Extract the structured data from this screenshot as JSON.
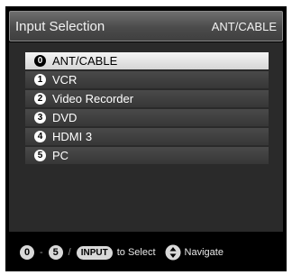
{
  "header": {
    "title": "Input Selection",
    "current_input": "ANT/CABLE"
  },
  "inputs": [
    {
      "number": "0",
      "label": "ANT/CABLE",
      "selected": true
    },
    {
      "number": "1",
      "label": "VCR",
      "selected": false
    },
    {
      "number": "2",
      "label": "Video Recorder",
      "selected": false
    },
    {
      "number": "3",
      "label": "DVD",
      "selected": false
    },
    {
      "number": "4",
      "label": "HDMI 3",
      "selected": false
    },
    {
      "number": "5",
      "label": "PC",
      "selected": false
    }
  ],
  "footer": {
    "key_start": "0",
    "range_sep": "-",
    "key_end": "5",
    "slash": "/",
    "input_key": "INPUT",
    "select_text": "to Select",
    "navigate_text": "Navigate",
    "nav_icon": "navigate-updown-icon"
  }
}
